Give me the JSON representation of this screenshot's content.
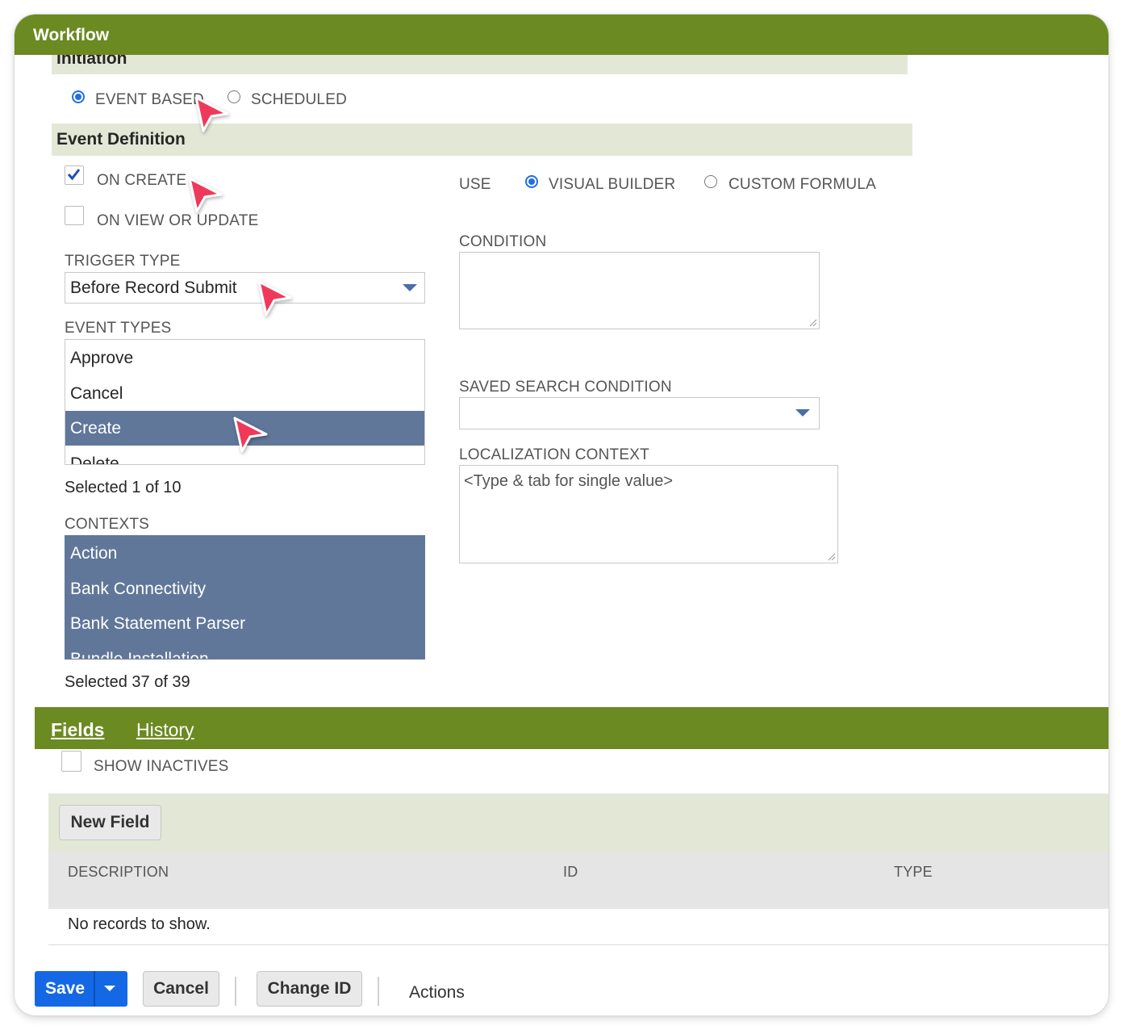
{
  "window": {
    "title": "Workflow"
  },
  "initiation": {
    "heading": "Initiation",
    "event_based": "EVENT BASED",
    "scheduled": "SCHEDULED"
  },
  "event_definition": {
    "heading": "Event Definition",
    "on_create": "ON CREATE",
    "on_view_or_update": "ON VIEW OR UPDATE",
    "trigger_type_label": "TRIGGER TYPE",
    "trigger_type_value": "Before Record Submit",
    "event_types_label": "EVENT TYPES",
    "event_types": [
      "Approve",
      "Cancel",
      "Create",
      "Delete"
    ],
    "event_types_selected": "Create",
    "event_types_count": "Selected 1 of 10",
    "contexts_label": "CONTEXTS",
    "contexts": [
      "Action",
      "Bank Connectivity",
      "Bank Statement Parser",
      "Bundle Installation"
    ],
    "contexts_count": "Selected 37 of 39",
    "use_label": "USE",
    "visual_builder": "VISUAL BUILDER",
    "custom_formula": "CUSTOM FORMULA",
    "condition_label": "CONDITION",
    "saved_search_label": "SAVED SEARCH CONDITION",
    "localization_label": "LOCALIZATION CONTEXT",
    "localization_placeholder": "<Type & tab for single value>"
  },
  "subtabs": {
    "fields": "Fields",
    "history": "History",
    "show_inactives": "SHOW INACTIVES",
    "new_field": "New Field",
    "columns": [
      "DESCRIPTION",
      "ID",
      "TYPE"
    ],
    "empty": "No records to show."
  },
  "footer": {
    "save": "Save",
    "cancel": "Cancel",
    "change_id": "Change ID",
    "actions": "Actions"
  },
  "colors": {
    "header_green": "#6b8a21",
    "section_band": "#e3e8d6",
    "selection_blue": "#607799",
    "primary_blue": "#1f6fe6",
    "annotation_pink": "#f0395a"
  }
}
